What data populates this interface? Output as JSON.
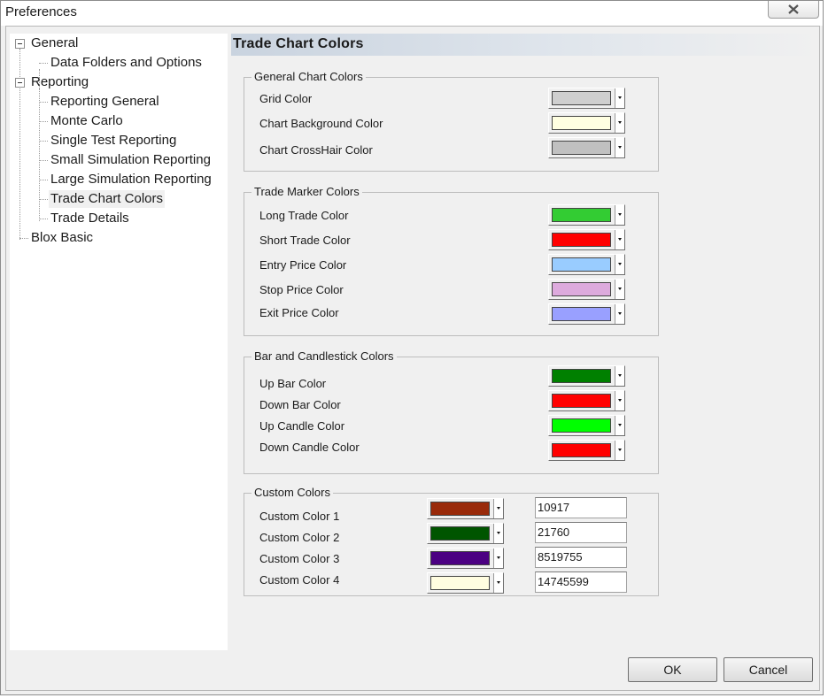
{
  "window": {
    "title": "Preferences"
  },
  "tree": {
    "general": "General",
    "data_folders": "Data Folders and Options",
    "reporting": "Reporting",
    "reporting_general": "Reporting General",
    "monte_carlo": "Monte Carlo",
    "single_test": "Single Test Reporting",
    "small_sim": "Small Simulation Reporting",
    "large_sim": "Large Simulation Reporting",
    "trade_chart_colors": "Trade Chart Colors",
    "trade_details": "Trade Details",
    "blox_basic": "Blox Basic",
    "selected": "Trade Chart Colors"
  },
  "page": {
    "title": "Trade Chart Colors"
  },
  "general_chart_colors": {
    "legend": "General Chart Colors",
    "items": [
      {
        "label": "Grid Color",
        "color": "#cfcfcf"
      },
      {
        "label": "Chart Background Color",
        "color": "#ffffe1"
      },
      {
        "label": "Chart CrossHair Color",
        "color": "#c0c0c0"
      }
    ]
  },
  "trade_marker_colors": {
    "legend": "Trade Marker Colors",
    "items": [
      {
        "label": "Long Trade Color",
        "color": "#33cc33"
      },
      {
        "label": "Short Trade Color",
        "color": "#ff0000"
      },
      {
        "label": "Entry Price Color",
        "color": "#99ccff"
      },
      {
        "label": "Stop Price Color",
        "color": "#ddaadd"
      },
      {
        "label": "Exit Price Color",
        "color": "#99a0ff"
      }
    ]
  },
  "bar_candle_colors": {
    "legend": "Bar and Candlestick Colors",
    "items": [
      {
        "label": "Up Bar Color",
        "color": "#008000"
      },
      {
        "label": "Down Bar Color",
        "color": "#ff0000"
      },
      {
        "label": "Up Candle Color",
        "color": "#00ff00"
      },
      {
        "label": "Down Candle Color",
        "color": "#ff0000"
      }
    ]
  },
  "custom_colors": {
    "legend": "Custom Colors",
    "items": [
      {
        "label": "Custom Color 1",
        "color": "#992a0a",
        "value": "10917"
      },
      {
        "label": "Custom Color 2",
        "color": "#005500",
        "value": "21760"
      },
      {
        "label": "Custom Color 3",
        "color": "#4b0082",
        "value": "8519755"
      },
      {
        "label": "Custom Color 4",
        "color": "#fffde0",
        "value": "14745599"
      }
    ]
  },
  "buttons": {
    "ok": "OK",
    "cancel": "Cancel"
  }
}
